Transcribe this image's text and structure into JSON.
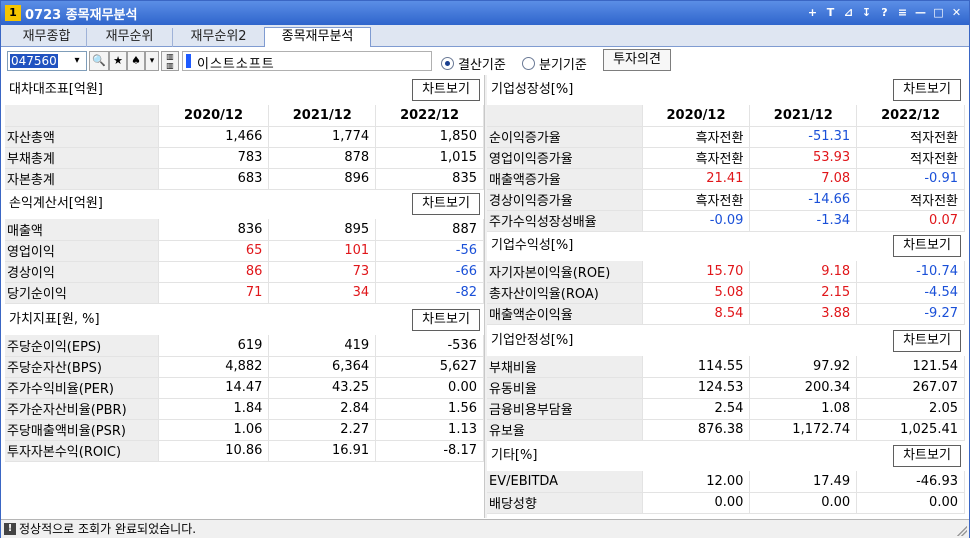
{
  "window": {
    "number": "1",
    "title": "0723 종목재무분석",
    "controls": [
      "+",
      "T",
      "⊿",
      "↧",
      "?",
      "≡",
      "—",
      "□",
      "✕"
    ]
  },
  "tabs": [
    "재무종합",
    "재무순위",
    "재무순위2",
    "종목재무분석"
  ],
  "toolbar": {
    "code": "047560",
    "name": "이스트소프트",
    "radio_annual": "결산기준",
    "radio_quarter": "분기기준",
    "opinion_button": "투자의견",
    "lock_glyph": "🔍",
    "star_glyph": "★",
    "spade_glyph": "♠",
    "dd_glyph": "▾"
  },
  "chart_button": "차트보기",
  "years": [
    "2020/12",
    "2021/12",
    "2022/12"
  ],
  "left": {
    "balance": {
      "title": "대차대조표[억원]",
      "rows": [
        {
          "label": "자산총액",
          "values": [
            "1,466",
            "1,774",
            "1,850"
          ],
          "colors": [
            "blk",
            "blk",
            "blk"
          ]
        },
        {
          "label": "부채총계",
          "values": [
            "783",
            "878",
            "1,015"
          ],
          "colors": [
            "blk",
            "blk",
            "blk"
          ]
        },
        {
          "label": "자본총계",
          "values": [
            "683",
            "896",
            "835"
          ],
          "colors": [
            "blk",
            "blk",
            "blk"
          ]
        }
      ]
    },
    "income": {
      "title": "손익계산서[억원]",
      "rows": [
        {
          "label": "매출액",
          "values": [
            "836",
            "895",
            "887"
          ],
          "colors": [
            "blk",
            "blk",
            "blk"
          ]
        },
        {
          "label": "영업이익",
          "values": [
            "65",
            "101",
            "-56"
          ],
          "colors": [
            "red",
            "red",
            "blue"
          ]
        },
        {
          "label": "경상이익",
          "values": [
            "86",
            "73",
            "-66"
          ],
          "colors": [
            "red",
            "red",
            "blue"
          ]
        },
        {
          "label": "당기순이익",
          "values": [
            "71",
            "34",
            "-82"
          ],
          "colors": [
            "red",
            "red",
            "blue"
          ]
        }
      ]
    },
    "value": {
      "title": "가치지표[원, %]",
      "rows": [
        {
          "label": "주당순이익(EPS)",
          "values": [
            "619",
            "419",
            "-536"
          ],
          "colors": [
            "blk",
            "blk",
            "blk"
          ]
        },
        {
          "label": "주당순자산(BPS)",
          "values": [
            "4,882",
            "6,364",
            "5,627"
          ],
          "colors": [
            "blk",
            "blk",
            "blk"
          ]
        },
        {
          "label": "주가수익비율(PER)",
          "values": [
            "14.47",
            "43.25",
            "0.00"
          ],
          "colors": [
            "blk",
            "blk",
            "blk"
          ]
        },
        {
          "label": "주가순자산비율(PBR)",
          "values": [
            "1.84",
            "2.84",
            "1.56"
          ],
          "colors": [
            "blk",
            "blk",
            "blk"
          ]
        },
        {
          "label": "주당매출액비율(PSR)",
          "values": [
            "1.06",
            "2.27",
            "1.13"
          ],
          "colors": [
            "blk",
            "blk",
            "blk"
          ]
        },
        {
          "label": "투자자본수익(ROIC)",
          "values": [
            "10.86",
            "16.91",
            "-8.17"
          ],
          "colors": [
            "blk",
            "blk",
            "blk"
          ]
        }
      ]
    }
  },
  "right": {
    "growth": {
      "title": "기업성장성[%]",
      "rows": [
        {
          "label": "순이익증가율",
          "values": [
            "흑자전환",
            "-51.31",
            "적자전환"
          ],
          "colors": [
            "blk",
            "blue",
            "blk"
          ]
        },
        {
          "label": "영업이익증가율",
          "values": [
            "흑자전환",
            "53.93",
            "적자전환"
          ],
          "colors": [
            "blk",
            "red",
            "blk"
          ]
        },
        {
          "label": "매출액증가율",
          "values": [
            "21.41",
            "7.08",
            "-0.91"
          ],
          "colors": [
            "red",
            "red",
            "blue"
          ]
        },
        {
          "label": "경상이익증가율",
          "values": [
            "흑자전환",
            "-14.66",
            "적자전환"
          ],
          "colors": [
            "blk",
            "blue",
            "blk"
          ]
        },
        {
          "label": "주가수익성장성배율",
          "values": [
            "-0.09",
            "-1.34",
            "0.07"
          ],
          "colors": [
            "blue",
            "blue",
            "red"
          ]
        }
      ]
    },
    "profit": {
      "title": "기업수익성[%]",
      "rows": [
        {
          "label": "자기자본이익율(ROE)",
          "values": [
            "15.70",
            "9.18",
            "-10.74"
          ],
          "colors": [
            "red",
            "red",
            "blue"
          ]
        },
        {
          "label": "총자산이익율(ROA)",
          "values": [
            "5.08",
            "2.15",
            "-4.54"
          ],
          "colors": [
            "red",
            "red",
            "blue"
          ]
        },
        {
          "label": "매출액순이익율",
          "values": [
            "8.54",
            "3.88",
            "-9.27"
          ],
          "colors": [
            "red",
            "red",
            "blue"
          ]
        }
      ]
    },
    "stability": {
      "title": "기업안정성[%]",
      "rows": [
        {
          "label": "부채비율",
          "values": [
            "114.55",
            "97.92",
            "121.54"
          ],
          "colors": [
            "blk",
            "blk",
            "blk"
          ]
        },
        {
          "label": "유동비율",
          "values": [
            "124.53",
            "200.34",
            "267.07"
          ],
          "colors": [
            "blk",
            "blk",
            "blk"
          ]
        },
        {
          "label": "금융비용부담율",
          "values": [
            "2.54",
            "1.08",
            "2.05"
          ],
          "colors": [
            "blk",
            "blk",
            "blk"
          ]
        },
        {
          "label": "유보율",
          "values": [
            "876.38",
            "1,172.74",
            "1,025.41"
          ],
          "colors": [
            "blk",
            "blk",
            "blk"
          ]
        }
      ]
    },
    "etc": {
      "title": "기타[%]",
      "rows": [
        {
          "label": "EV/EBITDA",
          "values": [
            "12.00",
            "17.49",
            "-46.93"
          ],
          "colors": [
            "blk",
            "blk",
            "blk"
          ]
        },
        {
          "label": "배당성향",
          "values": [
            "0.00",
            "0.00",
            "0.00"
          ],
          "colors": [
            "blk",
            "blk",
            "blk"
          ]
        }
      ]
    }
  },
  "status": {
    "icon": "!",
    "text": "정상적으로 조회가 완료되었습니다."
  }
}
